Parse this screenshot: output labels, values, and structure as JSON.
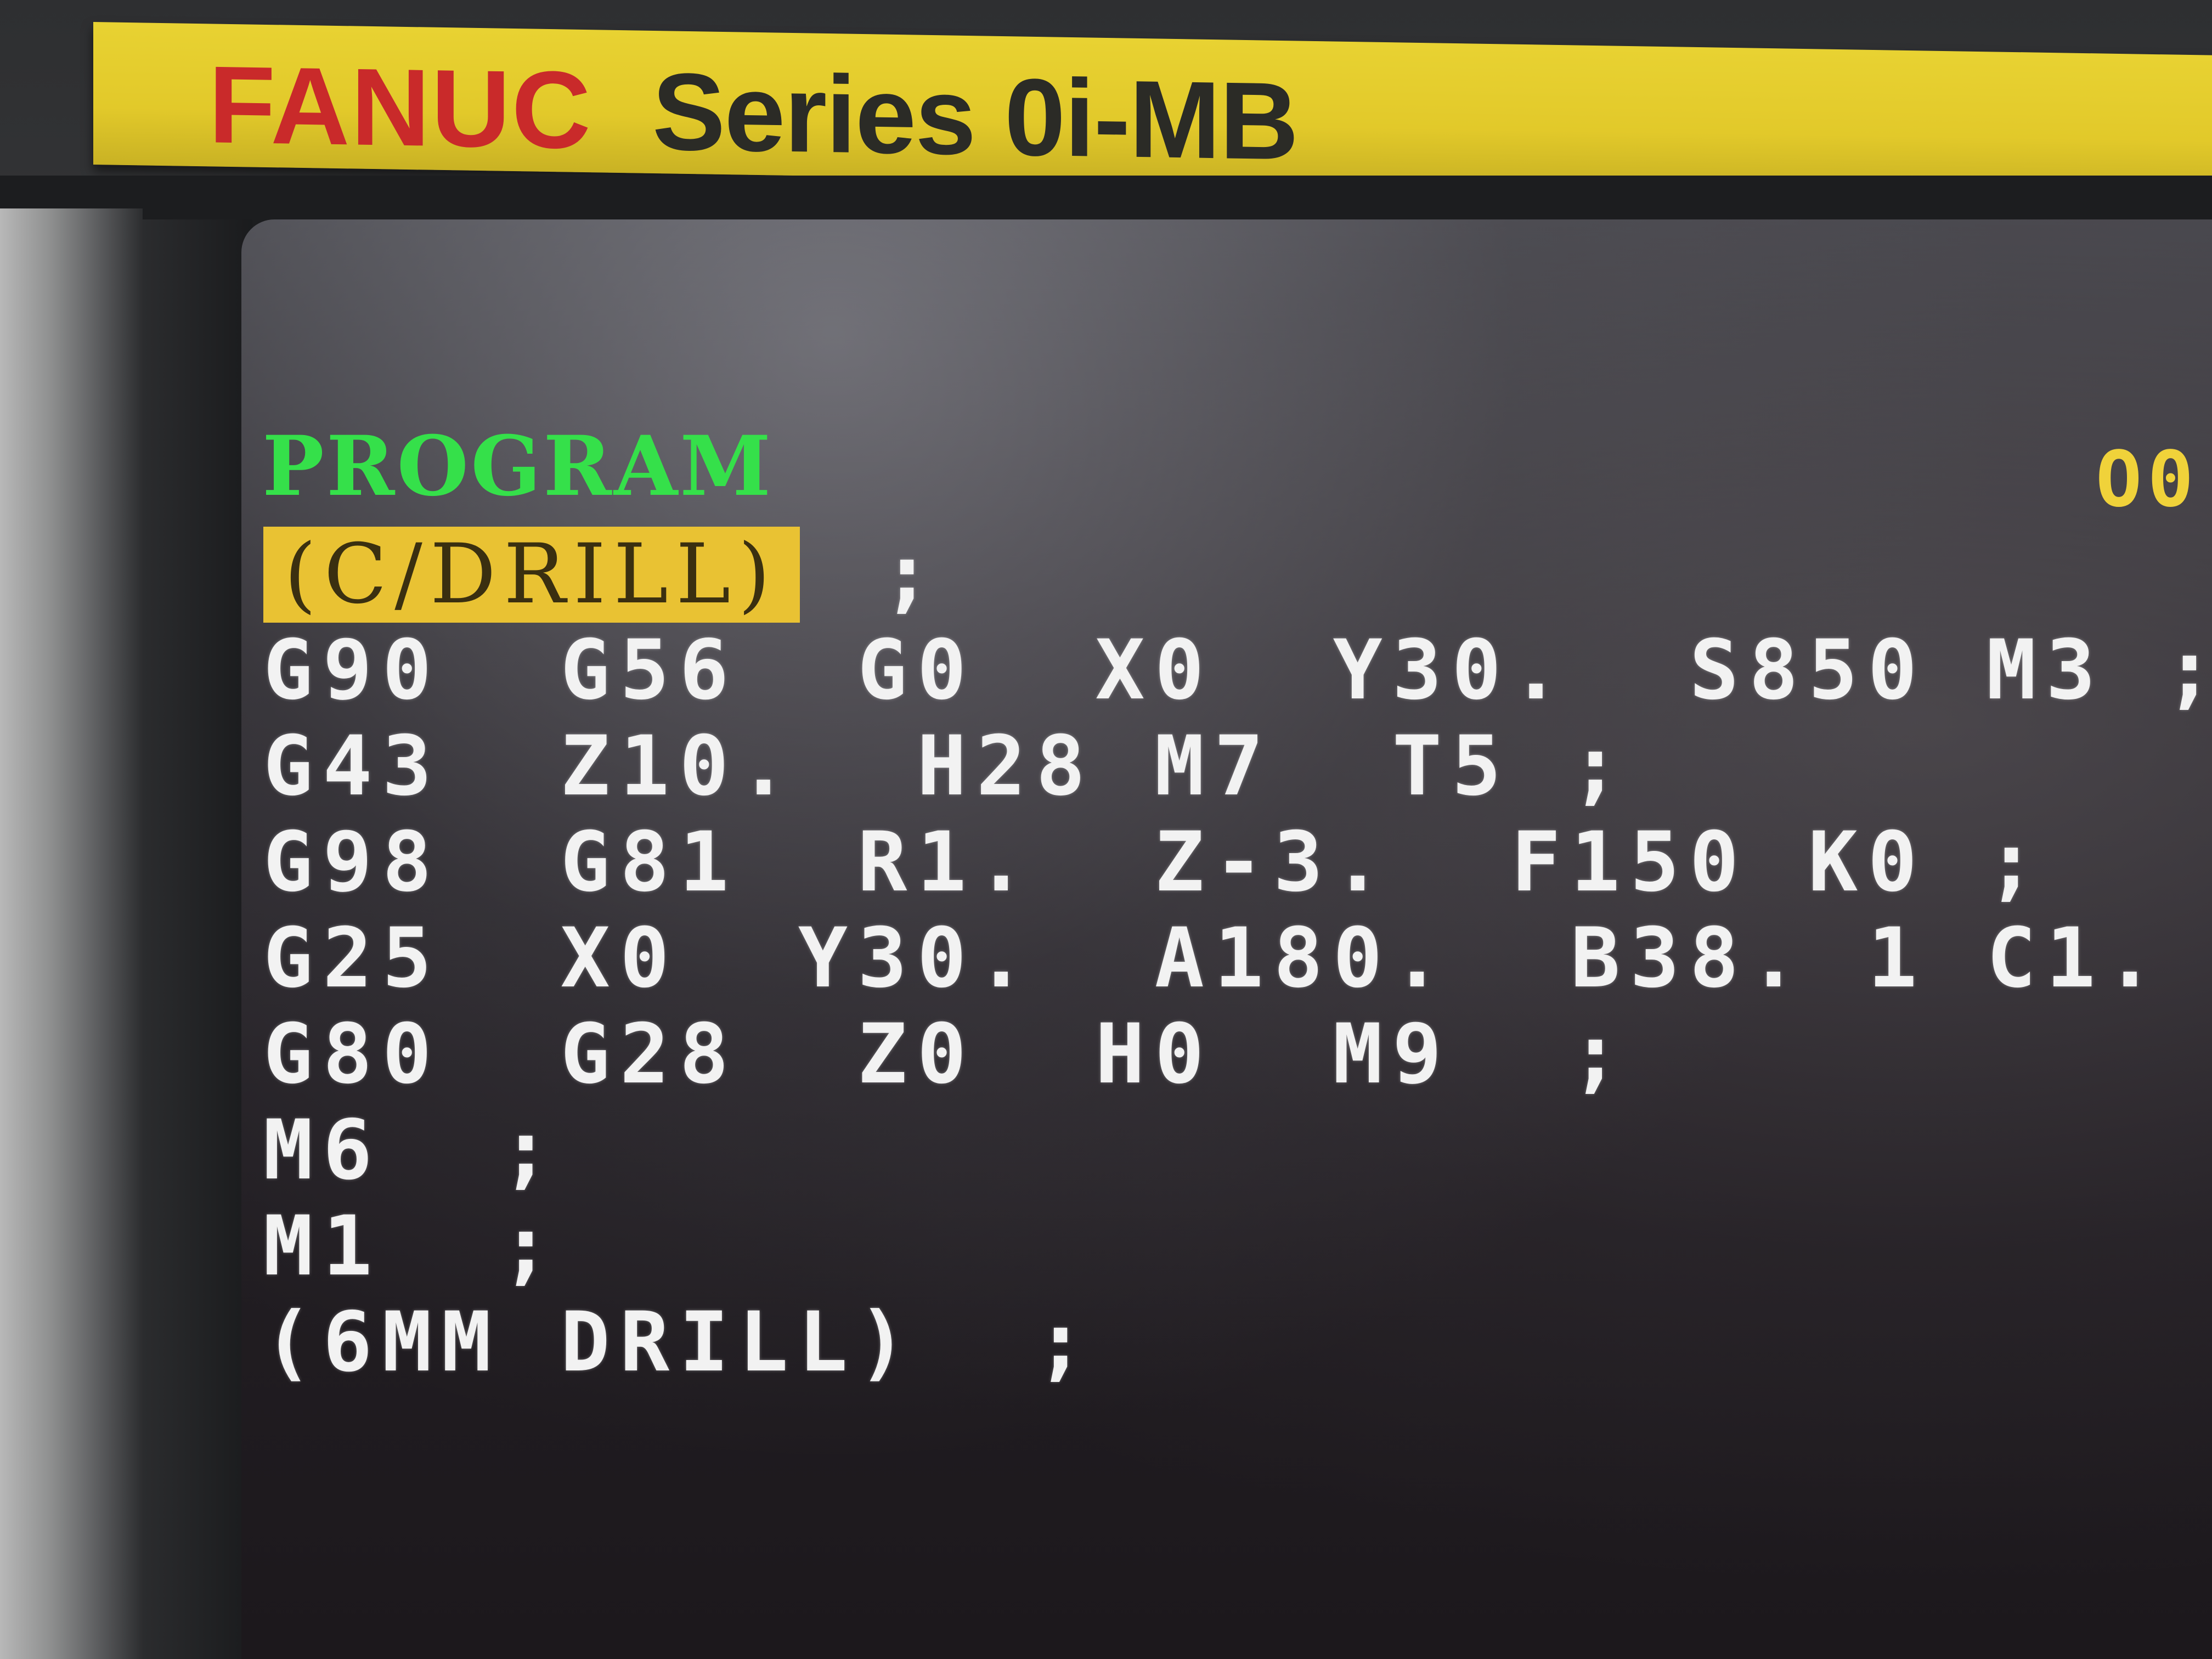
{
  "brand": {
    "maker": "FANUC",
    "model": "Series 0i-MB"
  },
  "screen": {
    "title": "PROGRAM",
    "program_number": "O0",
    "colors": {
      "title": "#35e04a",
      "program_number": "#f0d23a",
      "cursor_highlight": "#e9c233",
      "code_text": "#f2f2f2"
    }
  },
  "program": {
    "cursor_block": "(C/DRILL)",
    "cursor_eob": ";",
    "lines": [
      "G90  G56  G0  X0  Y30.  S850 M3 ;",
      "G43  Z10.  H28 M7  T5 ;",
      "G98  G81  R1.  Z-3.  F150 K0 ;",
      "G25  X0  Y30.  A180.  B38. 1 C1.  ;",
      "G80  G28  Z0  H0  M9  ;",
      "M6  ;",
      "M1  ;",
      "(6MM DRILL)  ;"
    ]
  }
}
